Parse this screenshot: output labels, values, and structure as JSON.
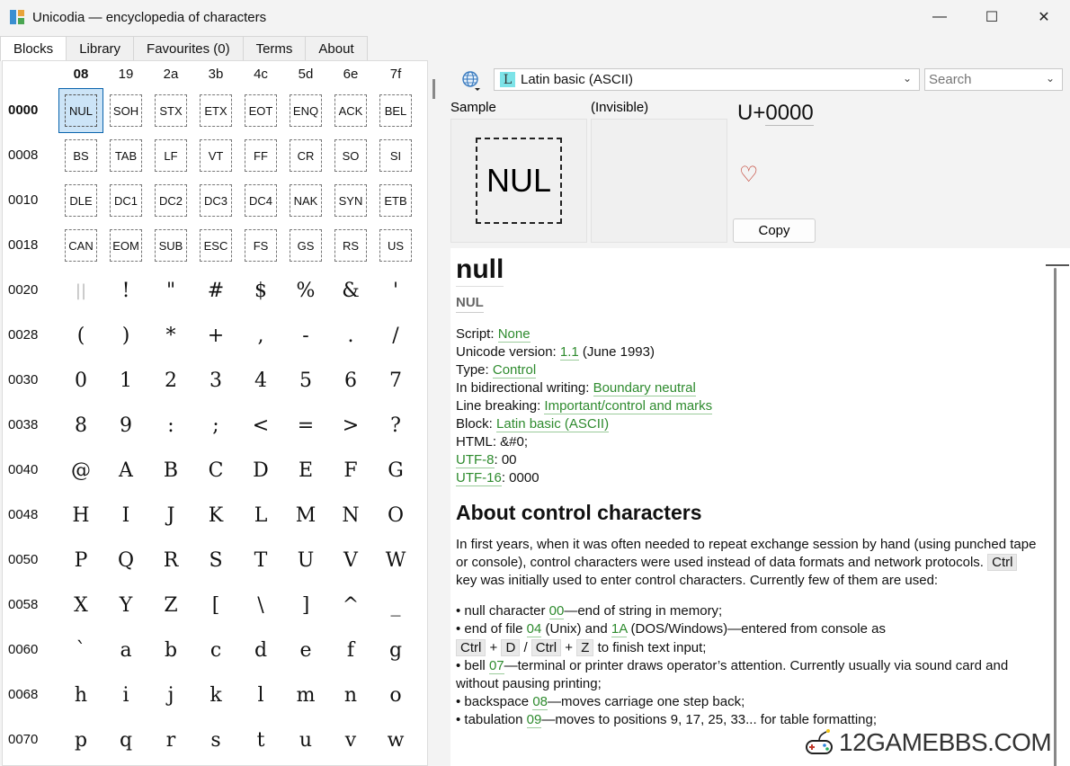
{
  "window": {
    "title": "Unicodia — encyclopedia of characters",
    "min_glyph": "—",
    "max_glyph": "☐",
    "close_glyph": "✕"
  },
  "tabs": [
    "Blocks",
    "Library",
    "Favourites (0)",
    "Terms",
    "About"
  ],
  "grid": {
    "col_headers": [
      "08",
      "19",
      "2a",
      "3b",
      "4c",
      "5d",
      "6e",
      "7f"
    ],
    "row_labels": [
      "0000",
      "0008",
      "0010",
      "0018",
      "0020",
      "0028",
      "0030",
      "0038",
      "0040",
      "0048",
      "0050",
      "0058",
      "0060",
      "0068",
      "0070"
    ],
    "rows": [
      [
        {
          "t": "NUL",
          "c": 1,
          "sel": 1
        },
        {
          "t": "SOH",
          "c": 1
        },
        {
          "t": "STX",
          "c": 1
        },
        {
          "t": "ETX",
          "c": 1
        },
        {
          "t": "EOT",
          "c": 1
        },
        {
          "t": "ENQ",
          "c": 1
        },
        {
          "t": "ACK",
          "c": 1
        },
        {
          "t": "BEL",
          "c": 1
        }
      ],
      [
        {
          "t": "BS",
          "c": 1
        },
        {
          "t": "TAB",
          "c": 1
        },
        {
          "t": "LF",
          "c": 1
        },
        {
          "t": "VT",
          "c": 1
        },
        {
          "t": "FF",
          "c": 1
        },
        {
          "t": "CR",
          "c": 1
        },
        {
          "t": "SO",
          "c": 1
        },
        {
          "t": "SI",
          "c": 1
        }
      ],
      [
        {
          "t": "DLE",
          "c": 1
        },
        {
          "t": "DC1",
          "c": 1
        },
        {
          "t": "DC2",
          "c": 1
        },
        {
          "t": "DC3",
          "c": 1
        },
        {
          "t": "DC4",
          "c": 1
        },
        {
          "t": "NAK",
          "c": 1
        },
        {
          "t": "SYN",
          "c": 1
        },
        {
          "t": "ETB",
          "c": 1
        }
      ],
      [
        {
          "t": "CAN",
          "c": 1
        },
        {
          "t": "EOM",
          "c": 1
        },
        {
          "t": "SUB",
          "c": 1
        },
        {
          "t": "ESC",
          "c": 1
        },
        {
          "t": "FS",
          "c": 1
        },
        {
          "t": "GS",
          "c": 1
        },
        {
          "t": "RS",
          "c": 1
        },
        {
          "t": "US",
          "c": 1
        }
      ],
      [
        {
          "t": "||",
          "sp": 1
        },
        {
          "t": "!"
        },
        {
          "t": "\""
        },
        {
          "t": "#"
        },
        {
          "t": "$"
        },
        {
          "t": "%"
        },
        {
          "t": "&"
        },
        {
          "t": "'"
        }
      ],
      [
        {
          "t": "("
        },
        {
          "t": ")"
        },
        {
          "t": "*"
        },
        {
          "t": "+"
        },
        {
          "t": ","
        },
        {
          "t": "-"
        },
        {
          "t": "."
        },
        {
          "t": "/"
        }
      ],
      [
        {
          "t": "0"
        },
        {
          "t": "1"
        },
        {
          "t": "2"
        },
        {
          "t": "3"
        },
        {
          "t": "4"
        },
        {
          "t": "5"
        },
        {
          "t": "6"
        },
        {
          "t": "7"
        }
      ],
      [
        {
          "t": "8"
        },
        {
          "t": "9"
        },
        {
          "t": ":"
        },
        {
          "t": ";"
        },
        {
          "t": "<"
        },
        {
          "t": "="
        },
        {
          "t": ">"
        },
        {
          "t": "?"
        }
      ],
      [
        {
          "t": "@"
        },
        {
          "t": "A"
        },
        {
          "t": "B"
        },
        {
          "t": "C"
        },
        {
          "t": "D"
        },
        {
          "t": "E"
        },
        {
          "t": "F"
        },
        {
          "t": "G"
        }
      ],
      [
        {
          "t": "H"
        },
        {
          "t": "I"
        },
        {
          "t": "J"
        },
        {
          "t": "K"
        },
        {
          "t": "L"
        },
        {
          "t": "M"
        },
        {
          "t": "N"
        },
        {
          "t": "O"
        }
      ],
      [
        {
          "t": "P"
        },
        {
          "t": "Q"
        },
        {
          "t": "R"
        },
        {
          "t": "S"
        },
        {
          "t": "T"
        },
        {
          "t": "U"
        },
        {
          "t": "V"
        },
        {
          "t": "W"
        }
      ],
      [
        {
          "t": "X"
        },
        {
          "t": "Y"
        },
        {
          "t": "Z"
        },
        {
          "t": "["
        },
        {
          "t": "\\"
        },
        {
          "t": "]"
        },
        {
          "t": "^"
        },
        {
          "t": "_"
        }
      ],
      [
        {
          "t": "`"
        },
        {
          "t": "a"
        },
        {
          "t": "b"
        },
        {
          "t": "c"
        },
        {
          "t": "d"
        },
        {
          "t": "e"
        },
        {
          "t": "f"
        },
        {
          "t": "g"
        }
      ],
      [
        {
          "t": "h"
        },
        {
          "t": "i"
        },
        {
          "t": "j"
        },
        {
          "t": "k"
        },
        {
          "t": "l"
        },
        {
          "t": "m"
        },
        {
          "t": "n"
        },
        {
          "t": "o"
        }
      ],
      [
        {
          "t": "p"
        },
        {
          "t": "q"
        },
        {
          "t": "r"
        },
        {
          "t": "s"
        },
        {
          "t": "t"
        },
        {
          "t": "u"
        },
        {
          "t": "v"
        },
        {
          "t": "w"
        }
      ]
    ]
  },
  "toolbar": {
    "block_icon": "L",
    "block_name": "Latin basic (ASCII)",
    "search_placeholder": "Search"
  },
  "sample": {
    "label": "Sample",
    "invisible_label": "(Invisible)",
    "glyph": "NUL",
    "code_prefix": "U+",
    "code_num": "0000",
    "favourite_icon": "♡",
    "copy_label": "Copy"
  },
  "info": {
    "name": "null",
    "abbr": "NUL",
    "props": {
      "script_k": "Script: ",
      "script_v": "None",
      "version_k": "Unicode version: ",
      "version_v": "1.1",
      "version_tail": " (June 1993)",
      "type_k": "Type: ",
      "type_v": "Control",
      "bidi_k": "In bidirectional writing: ",
      "bidi_v": "Boundary neutral",
      "lb_k": "Line breaking: ",
      "lb_v": "Important/control and marks",
      "block_k": "Block: ",
      "block_v": "Latin basic (ASCII)",
      "html_k": "HTML: ",
      "html_v": "&#0;",
      "utf8_k": "UTF-8",
      "utf8_v": ": 00",
      "utf16_k": "UTF-16",
      "utf16_v": ": 0000"
    },
    "about_title": "About control characters",
    "about_p1": "In first years, when it was often needed to repeat exchange session by hand (using punched tape or console), control characters were used instead of data formats and network protocols. ",
    "about_p1_kbd": "Ctrl",
    "about_p1_tail": " key was initially used to enter control characters. Currently few of them are used:",
    "b1_a": "• null character ",
    "b1_l": "00",
    "b1_b": "—end of string in memory;",
    "b2_a": "• end of file ",
    "b2_l1": "04",
    "b2_b": " (Unix) and ",
    "b2_l2": "1A",
    "b2_c": " (DOS/Windows)—entered from console as",
    "b2_k1": "Ctrl",
    "b2_p1": " + ",
    "b2_k2": "D",
    "b2_s": " / ",
    "b2_k3": "Ctrl",
    "b2_p2": " + ",
    "b2_k4": "Z",
    "b2_d": " to finish text input;",
    "b3_a": "• bell ",
    "b3_l": "07",
    "b3_b": "—terminal or printer draws operator’s attention. Currently usually via sound card and without pausing printing;",
    "b4_a": "• backspace ",
    "b4_l": "08",
    "b4_b": "—moves carriage one step back;",
    "b5_a": "• tabulation ",
    "b5_l": "09",
    "b5_b": "—moves to positions 9, 17, 25, 33... for table formatting;"
  },
  "watermark": "12GAMEBBS.COM"
}
